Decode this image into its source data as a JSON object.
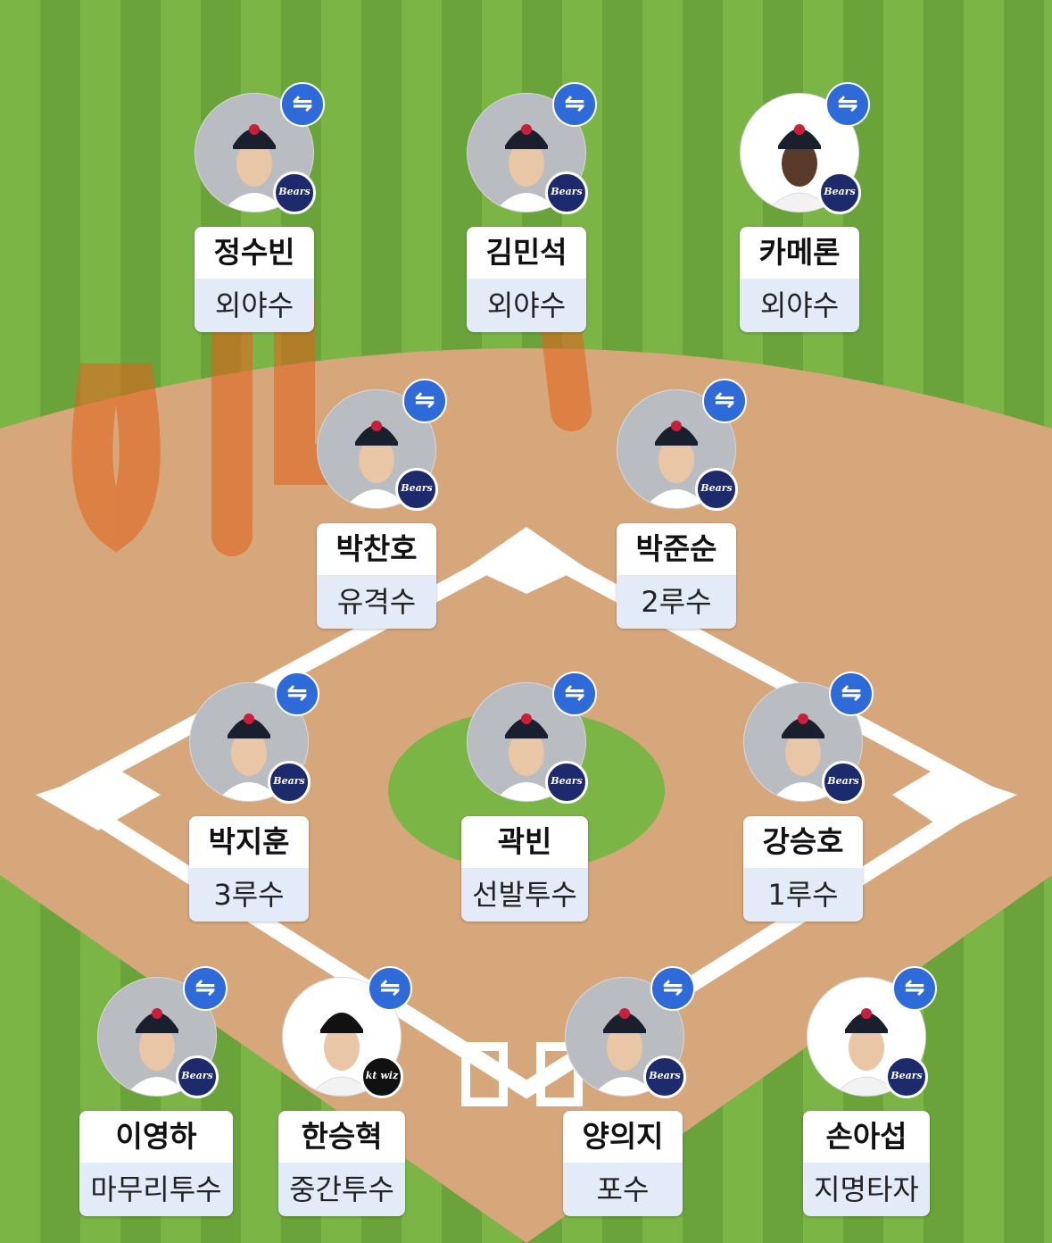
{
  "colors": {
    "grass_light": "#7ab546",
    "grass_dark": "#6aa33a",
    "infield_dirt": "#d7a77c",
    "swap_badge": "#2f6ad9",
    "position_bg": "#e3ebf8",
    "watermark": "#e0661f"
  },
  "icons": {
    "swap": "⇋",
    "bears_logo": "Bears",
    "kt_logo": "kt wiz"
  },
  "players": [
    {
      "name": "정수빈",
      "position": "외야수",
      "team": "bears"
    },
    {
      "name": "김민석",
      "position": "외야수",
      "team": "bears"
    },
    {
      "name": "카메론",
      "position": "외야수",
      "team": "bears"
    },
    {
      "name": "박찬호",
      "position": "유격수",
      "team": "bears"
    },
    {
      "name": "박준순",
      "position": "2루수",
      "team": "bears"
    },
    {
      "name": "박지훈",
      "position": "3루수",
      "team": "bears"
    },
    {
      "name": "곽빈",
      "position": "선발투수",
      "team": "bears"
    },
    {
      "name": "강승호",
      "position": "1루수",
      "team": "bears"
    },
    {
      "name": "이영하",
      "position": "마무리투수",
      "team": "bears"
    },
    {
      "name": "한승혁",
      "position": "중간투수",
      "team": "kt"
    },
    {
      "name": "양의지",
      "position": "포수",
      "team": "bears"
    },
    {
      "name": "손아섭",
      "position": "지명타자",
      "team": "bears"
    }
  ]
}
